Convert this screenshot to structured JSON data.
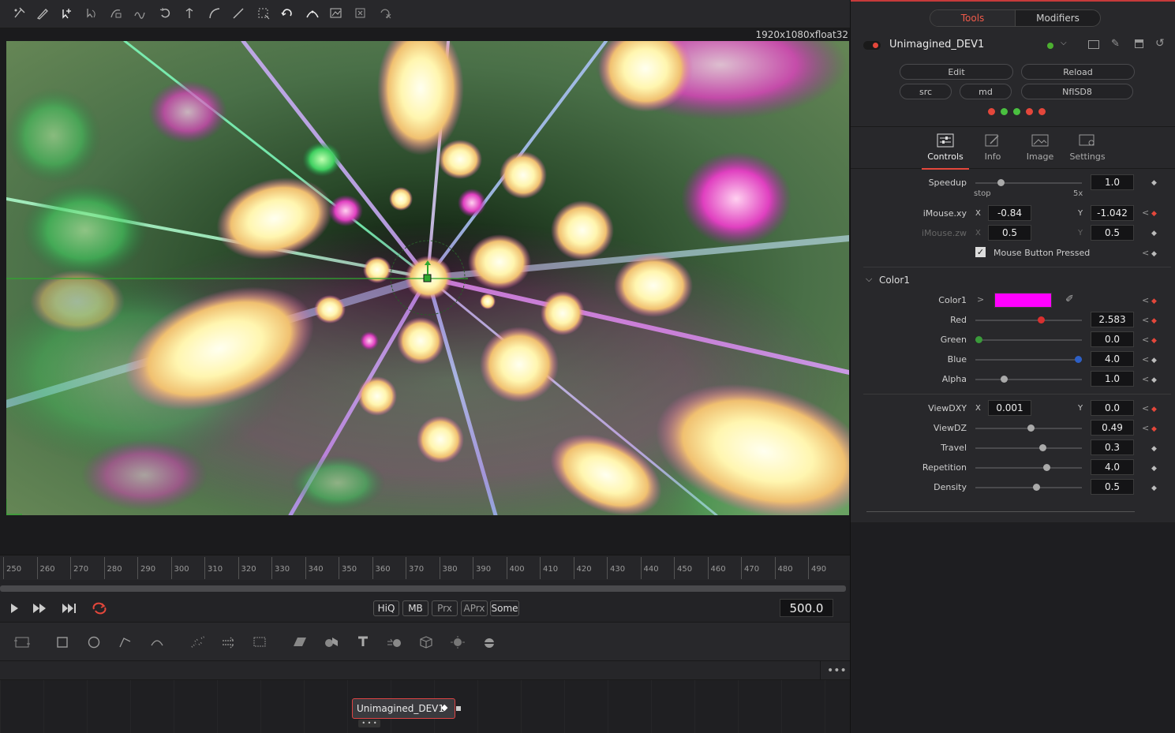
{
  "viewer": {
    "resolution": "1920x1080xfloat32"
  },
  "timeline": {
    "ticks": [
      "250",
      "260",
      "270",
      "280",
      "290",
      "300",
      "310",
      "320",
      "330",
      "340",
      "350",
      "360",
      "370",
      "380",
      "390",
      "400",
      "410",
      "420",
      "430",
      "440",
      "450",
      "460",
      "470",
      "480",
      "490"
    ]
  },
  "transport": {
    "hiq": "HiQ",
    "mb": "MB",
    "prx": "Prx",
    "aprx": "APrx",
    "some": "Some",
    "frame": "500.0"
  },
  "node": {
    "name": "Unimagined_DEV1"
  },
  "inspector": {
    "tab_tools": "Tools",
    "tab_modifiers": "Modifiers",
    "tool_name": "Unimagined_DEV1",
    "btn_edit": "Edit",
    "btn_reload": "Reload",
    "btn_src": "src",
    "btn_md": "md",
    "btn_nfisd8": "NfISD8",
    "tabs": {
      "controls": "Controls",
      "info": "Info",
      "image": "Image",
      "settings": "Settings"
    },
    "speedup": {
      "label": "Speedup",
      "value": "1.0",
      "min": "stop",
      "max": "5x",
      "level": 0.22
    },
    "imouse_xy": {
      "label": "iMouse.xy",
      "x_label": "X",
      "x": "-0.84",
      "y_label": "Y",
      "y": "-1.042"
    },
    "imouse_zw": {
      "label": "iMouse.zw",
      "x_label": "X",
      "x": "0.5",
      "y_label": "Y",
      "y": "0.5"
    },
    "mouse_pressed": "Mouse Button Pressed",
    "color_group": "Color1",
    "color1": {
      "label": "Color1",
      "swatch": "#ff00ff"
    },
    "red": {
      "label": "Red",
      "value": "2.583",
      "level": 0.63
    },
    "green": {
      "label": "Green",
      "value": "0.0",
      "level": 0.0
    },
    "blue": {
      "label": "Blue",
      "value": "4.0",
      "level": 1.0
    },
    "alpha": {
      "label": "Alpha",
      "value": "1.0",
      "level": 0.25
    },
    "viewdxy": {
      "label": "ViewDXY",
      "x_label": "X",
      "x": "0.001",
      "y_label": "Y",
      "y": "0.0"
    },
    "viewdz": {
      "label": "ViewDZ",
      "value": "0.49",
      "level": 0.52
    },
    "travel": {
      "label": "Travel",
      "value": "0.3",
      "level": 0.64
    },
    "repetition": {
      "label": "Repetition",
      "value": "4.0",
      "level": 0.68
    },
    "density": {
      "label": "Density",
      "value": "0.5",
      "level": 0.58
    }
  },
  "colors": {
    "accent": "#e4473b",
    "active_tab": "#f05a4a"
  }
}
